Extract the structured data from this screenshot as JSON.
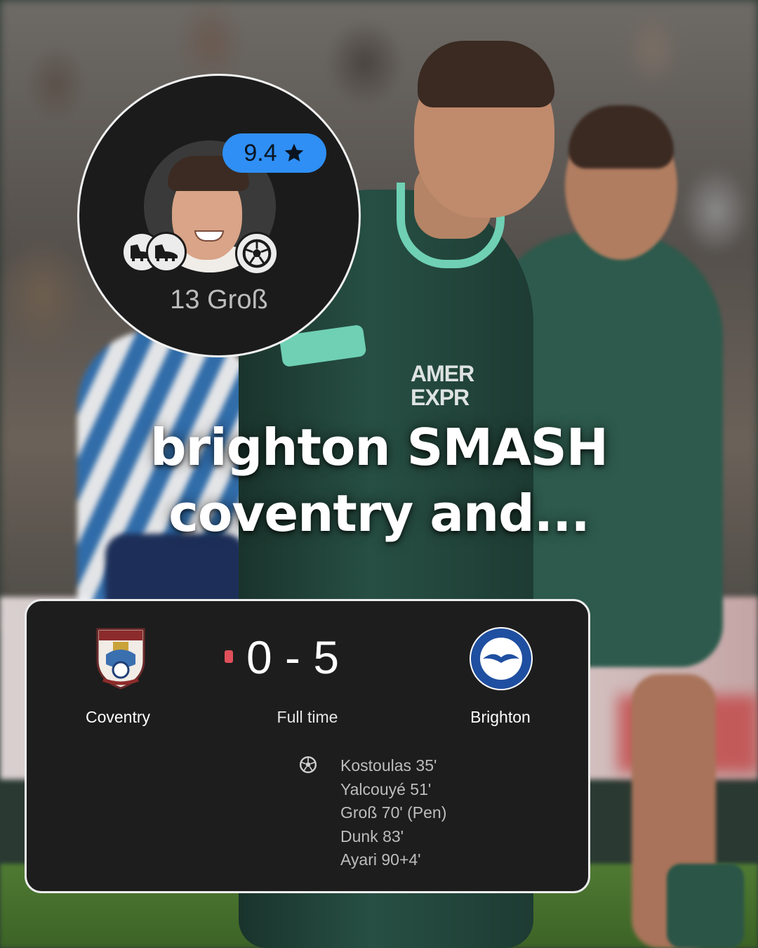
{
  "headline": {
    "line1": "brighton SMASH",
    "line2": "coventry and..."
  },
  "player_card": {
    "rating": "9.4",
    "rating_icon": "star-icon",
    "label": "13 Groß",
    "badges": [
      "boot-icon",
      "boot-icon",
      "football-icon"
    ],
    "rating_color": "#2f8ff5"
  },
  "match": {
    "home_team": "Coventry",
    "away_team": "Brighton",
    "score": "0 - 5",
    "status": "Full time",
    "live_indicator_color": "#e0505a",
    "goal_icon": "football-icon",
    "scorers": [
      "Kostoulas 35'",
      "Yalcouyé 51'",
      "Groß 70' (Pen)",
      "Dunk 83'",
      "Ayari 90+4'"
    ]
  },
  "background": {
    "sponsor_lines": [
      "AMER",
      "EXPR"
    ]
  }
}
